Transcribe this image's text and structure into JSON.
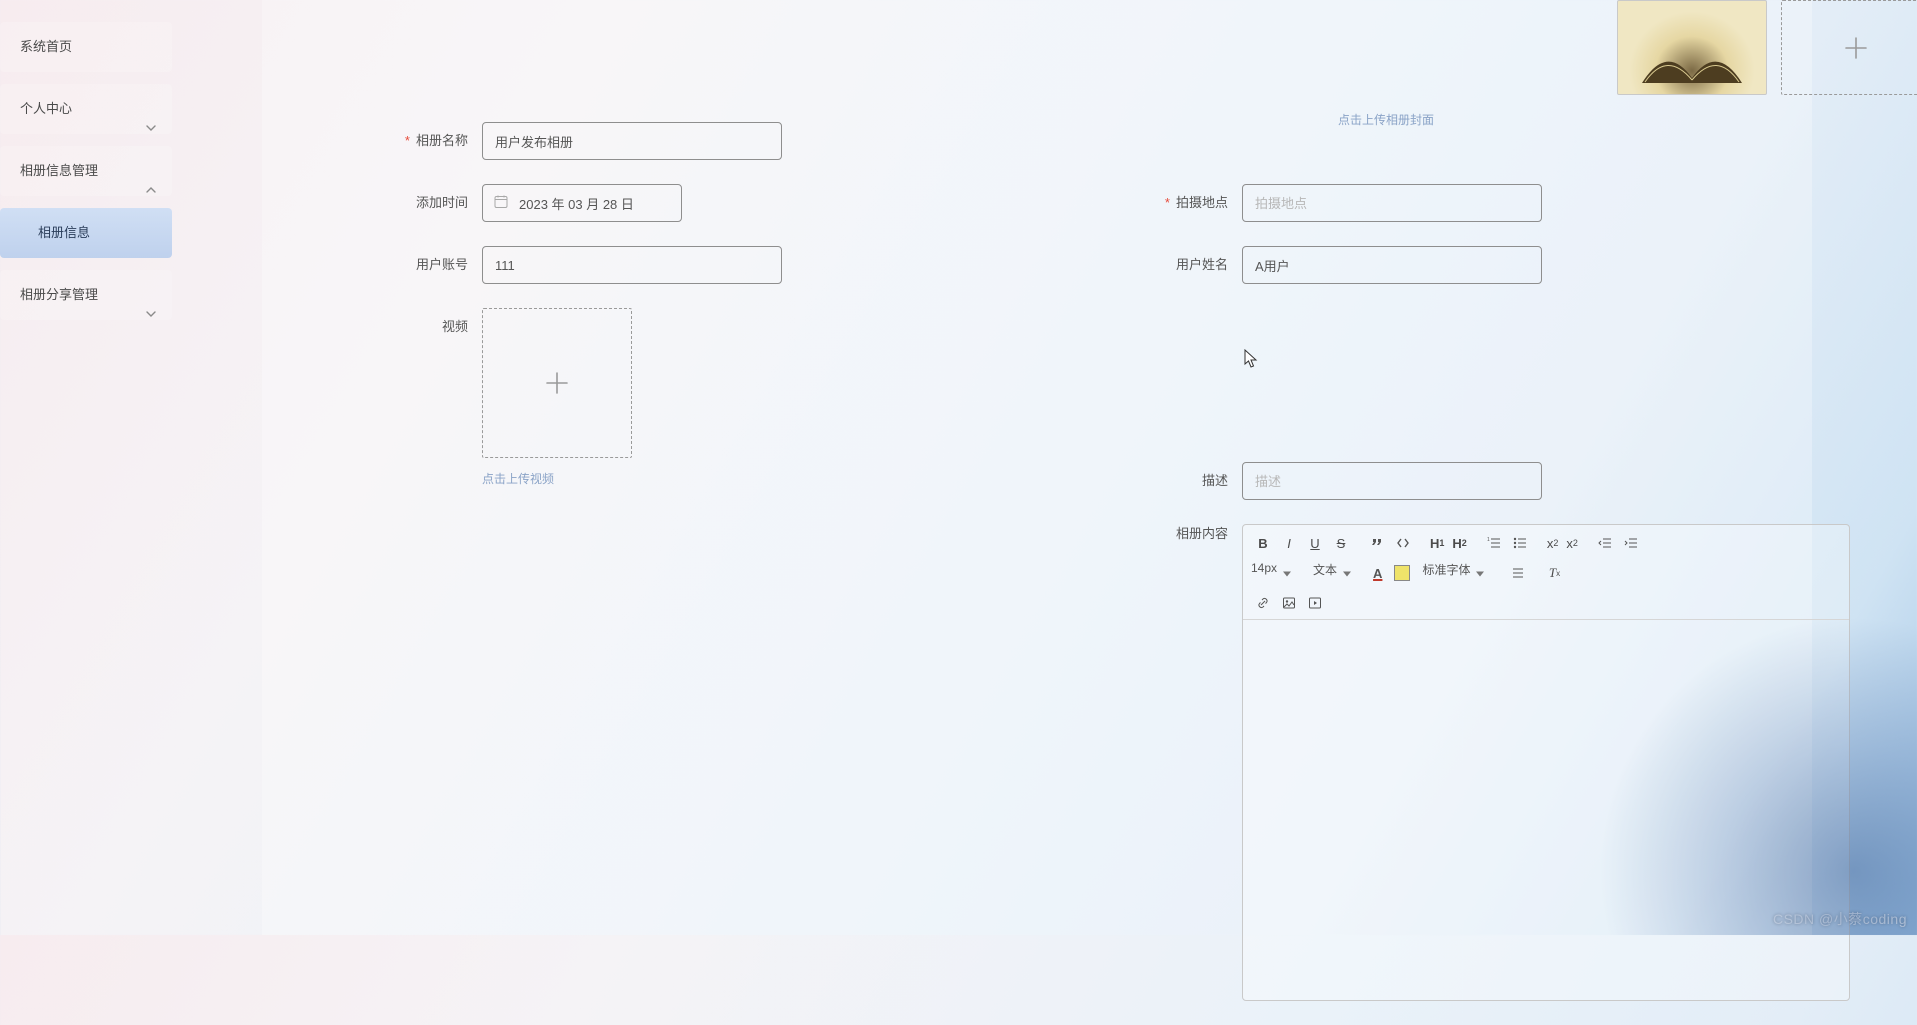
{
  "sidebar": {
    "items": [
      {
        "label": "系统首页"
      },
      {
        "label": "个人中心"
      },
      {
        "label": "相册信息管理"
      },
      {
        "label": "相册信息"
      },
      {
        "label": "相册分享管理"
      }
    ]
  },
  "cover": {
    "hint": "点击上传相册封面"
  },
  "form": {
    "album_name": {
      "label": "相册名称",
      "value": "用户发布相册"
    },
    "add_time": {
      "label": "添加时间",
      "value": "2023 年 03 月 28 日"
    },
    "location": {
      "label": "拍摄地点",
      "placeholder": "拍摄地点"
    },
    "user_account": {
      "label": "用户账号",
      "value": "111"
    },
    "user_name": {
      "label": "用户姓名",
      "value": "A用户"
    },
    "video": {
      "label": "视频",
      "hint": "点击上传视频"
    },
    "desc": {
      "label": "描述",
      "placeholder": "描述"
    },
    "content": {
      "label": "相册内容"
    }
  },
  "editor": {
    "font_size": "14px",
    "block_type": "文本",
    "font_family": "标准字体"
  },
  "watermark": "CSDN @小蔡coding"
}
